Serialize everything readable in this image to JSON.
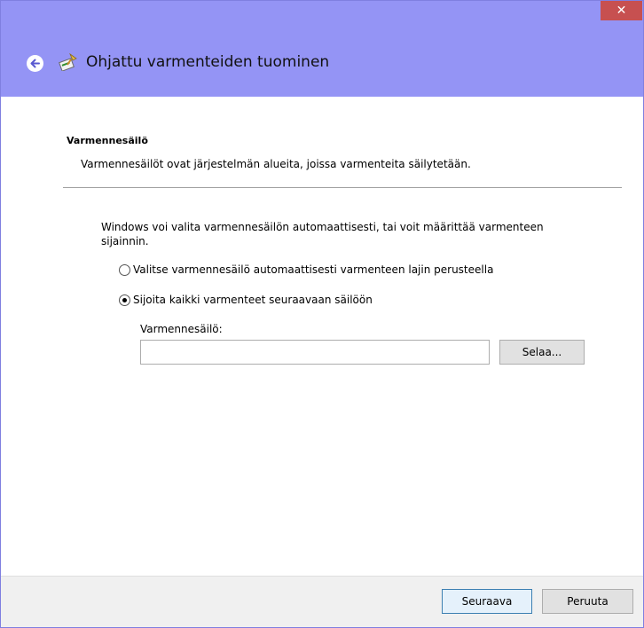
{
  "window": {
    "close_glyph": "✕"
  },
  "header": {
    "title": "Ohjattu varmenteiden tuominen"
  },
  "section": {
    "heading": "Varmennesäilö",
    "description": "Varmennesäilöt ovat järjestelmän alueita, joissa varmenteita säilytetään."
  },
  "main": {
    "intro": "Windows voi valita varmennesäilön automaattisesti, tai voit määrittää varmenteen sijainnin.",
    "options": [
      {
        "label": "Valitse varmennesäilö automaattisesti varmenteen lajin perusteella",
        "selected": false
      },
      {
        "label": "Sijoita kaikki varmenteet seuraavaan säilöön",
        "selected": true
      }
    ],
    "store_field": {
      "label": "Varmennesäilö:",
      "value": ""
    },
    "browse_label": "Selaa..."
  },
  "footer": {
    "next_label": "Seuraava",
    "cancel_label": "Peruuta"
  },
  "colors": {
    "header_bg": "#9494f5",
    "close_bg": "#c75050",
    "footer_bg": "#f0f0f0"
  }
}
